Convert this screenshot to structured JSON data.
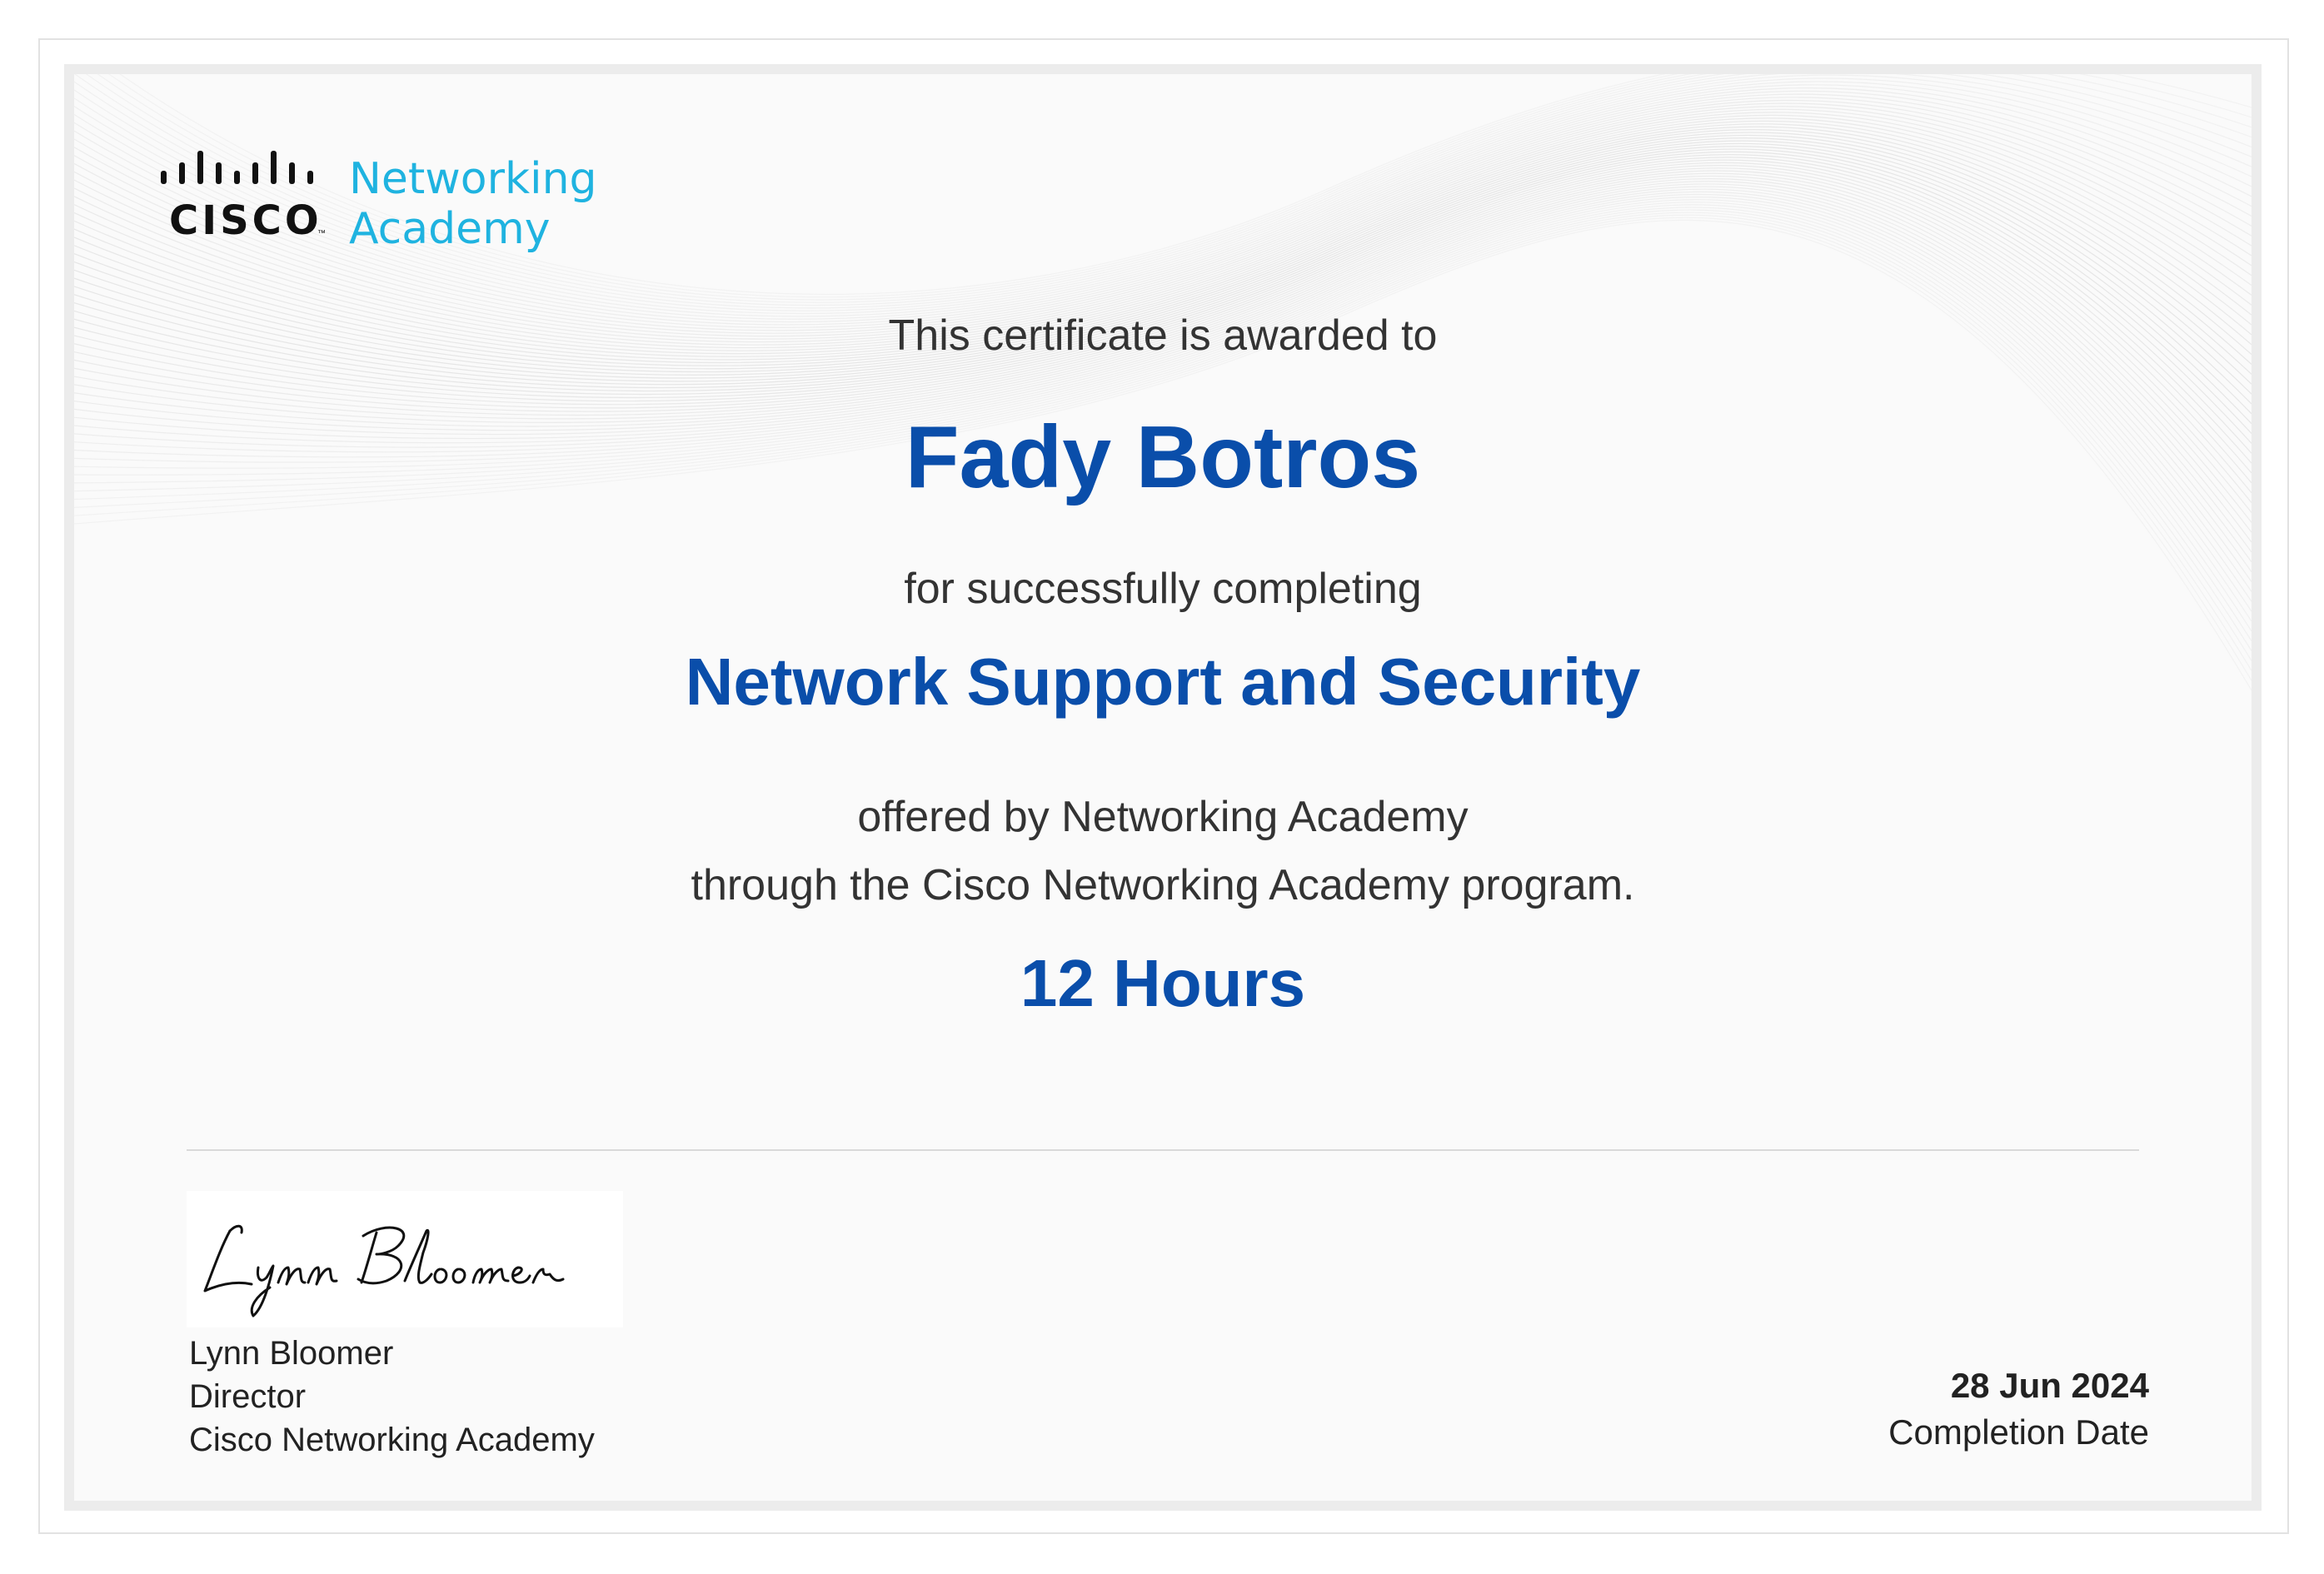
{
  "logo": {
    "brand": "CISCO",
    "product_line1": "Networking",
    "product_line2": "Academy"
  },
  "certificate": {
    "intro": "This certificate is awarded to",
    "recipient": "Fady Botros",
    "completing": "for successfully completing",
    "course": "Network Support and Security",
    "offered_by": "offered by Networking Academy",
    "program": "through the Cisco Networking Academy program.",
    "hours": "12 Hours"
  },
  "signatory": {
    "signature": "Lynn Bloomer",
    "name": "Lynn Bloomer",
    "title": "Director",
    "organization": "Cisco Networking Academy"
  },
  "completion": {
    "date": "28 Jun 2024",
    "label": "Completion Date"
  },
  "colors": {
    "accent_blue": "#0a4eaa",
    "logo_cyan": "#1fb3e0",
    "text": "#333333"
  }
}
